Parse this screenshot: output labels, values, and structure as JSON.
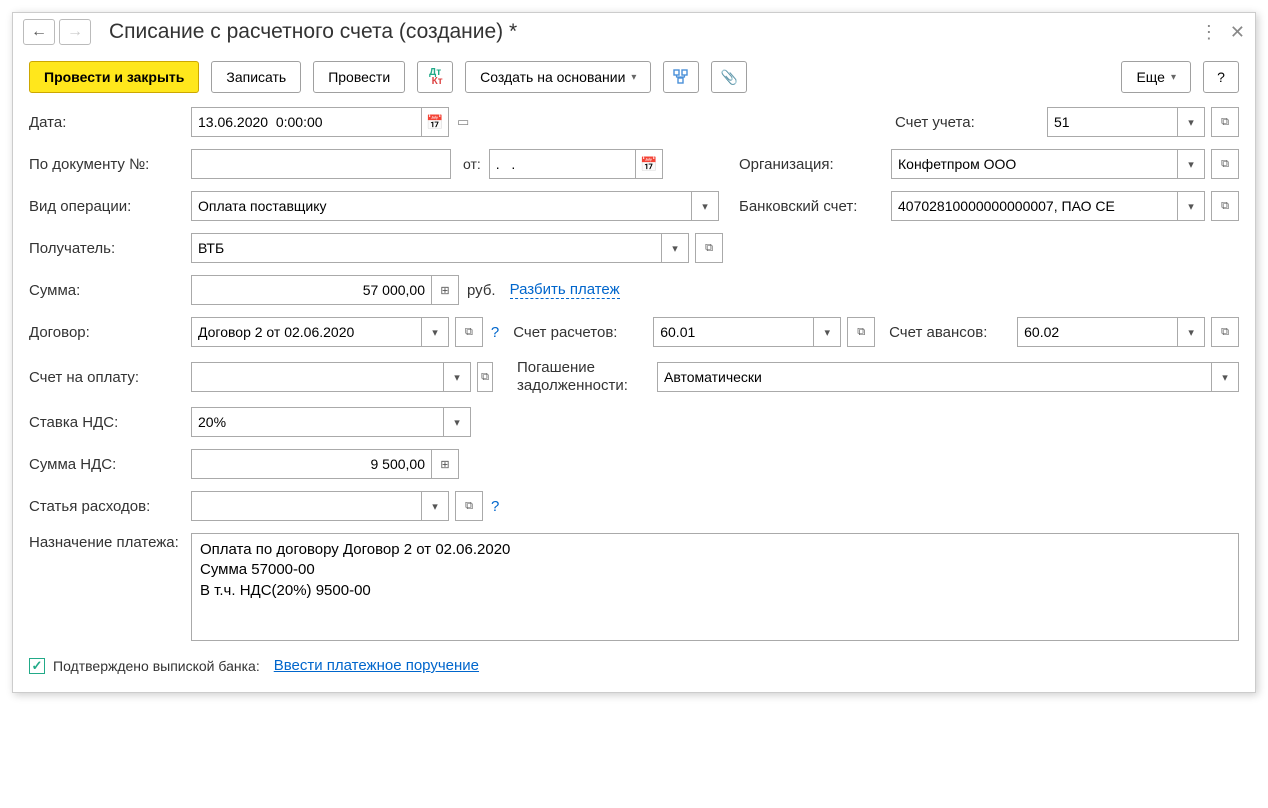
{
  "header": {
    "title": "Списание с расчетного счета (создание) *"
  },
  "toolbar": {
    "post_close": "Провести и закрыть",
    "save": "Записать",
    "post": "Провести",
    "create_based": "Создать на основании",
    "more": "Еще"
  },
  "fields": {
    "date_label": "Дата:",
    "date_value": "13.06.2020  0:00:00",
    "account_label": "Счет учета:",
    "account_value": "51",
    "docnum_label": "По документу №:",
    "docnum_value": "",
    "from_label": "от:",
    "from_value": ".   .",
    "org_label": "Организация:",
    "org_value": "Конфетпром ООО",
    "optype_label": "Вид операции:",
    "optype_value": "Оплата поставщику",
    "bankacc_label": "Банковский счет:",
    "bankacc_value": "40702810000000000007, ПАО СЕ",
    "recipient_label": "Получатель:",
    "recipient_value": "ВТБ",
    "sum_label": "Сумма:",
    "sum_value": "57 000,00",
    "currency": "руб.",
    "split_link": "Разбить платеж",
    "contract_label": "Договор:",
    "contract_value": "Договор 2 от 02.06.2020",
    "settle_acc_label": "Счет расчетов:",
    "settle_acc_value": "60.01",
    "advance_acc_label": "Счет авансов:",
    "advance_acc_value": "60.02",
    "invoice_label": "Счет на оплату:",
    "invoice_value": "",
    "debt_label": "Погашение задолженности:",
    "debt_value": "Автоматически",
    "vat_rate_label": "Ставка НДС:",
    "vat_rate_value": "20%",
    "vat_sum_label": "Сумма НДС:",
    "vat_sum_value": "9 500,00",
    "expense_label": "Статья расходов:",
    "expense_value": "",
    "purpose_label": "Назначение платежа:",
    "purpose_value": "Оплата по договору Договор 2 от 02.06.2020\nСумма 57000-00\nВ т.ч. НДС(20%) 9500-00",
    "confirmed_label": "Подтверждено выпиской банка:",
    "enter_order_link": "Ввести платежное поручение"
  }
}
